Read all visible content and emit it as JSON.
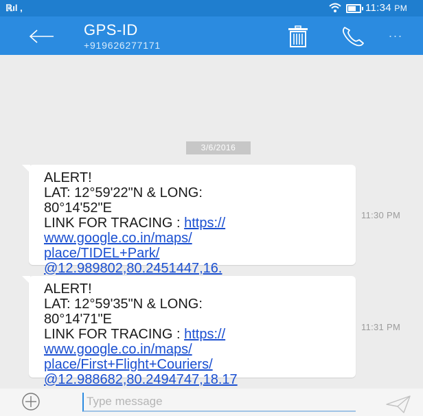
{
  "status_bar": {
    "signal": "ℝıl ,",
    "wifi_icon": "wifi-icon",
    "battery_icon": "battery-icon",
    "time": "11:34",
    "ampm": "PM"
  },
  "app_bar": {
    "contact_name": "GPS-ID",
    "contact_number": "+919626277171",
    "icons": [
      "back-arrow-icon",
      "trash-icon",
      "phone-icon",
      "more-icon"
    ],
    "more_label": "..."
  },
  "conversation": {
    "date": "3/6/2016",
    "messages": [
      {
        "line1": "ALERT!",
        "line2": "LAT: 12°59'22\"N & LONG:",
        "line3": "80°14'52\"E",
        "link_prefix": "LINK FOR TRACING : ",
        "link_1": "https://",
        "link_2": "www.google.co.in/maps/",
        "link_3": "place/TIDEL+Park/",
        "link_4": "@12.989802,80.2451447,16.",
        "time": "11:30 PM"
      },
      {
        "line1": "ALERT!",
        "line2": "LAT: 12°59'35\"N & LONG:",
        "line3": "80°14'71\"E",
        "link_prefix": "LINK FOR TRACING : ",
        "link_1": "https://",
        "link_2": "www.google.co.in/maps/",
        "link_3": "place/First+Flight+Couriers/",
        "link_4": "@12.988682,80.2494747,18.17",
        "time": "11:31 PM"
      }
    ]
  },
  "composer": {
    "placeholder": "Type message",
    "value": ""
  },
  "colors": {
    "status_bar": "#1f7ecf",
    "app_bar": "#2b8be0",
    "background": "#ececec",
    "link": "#1a4fd1"
  }
}
